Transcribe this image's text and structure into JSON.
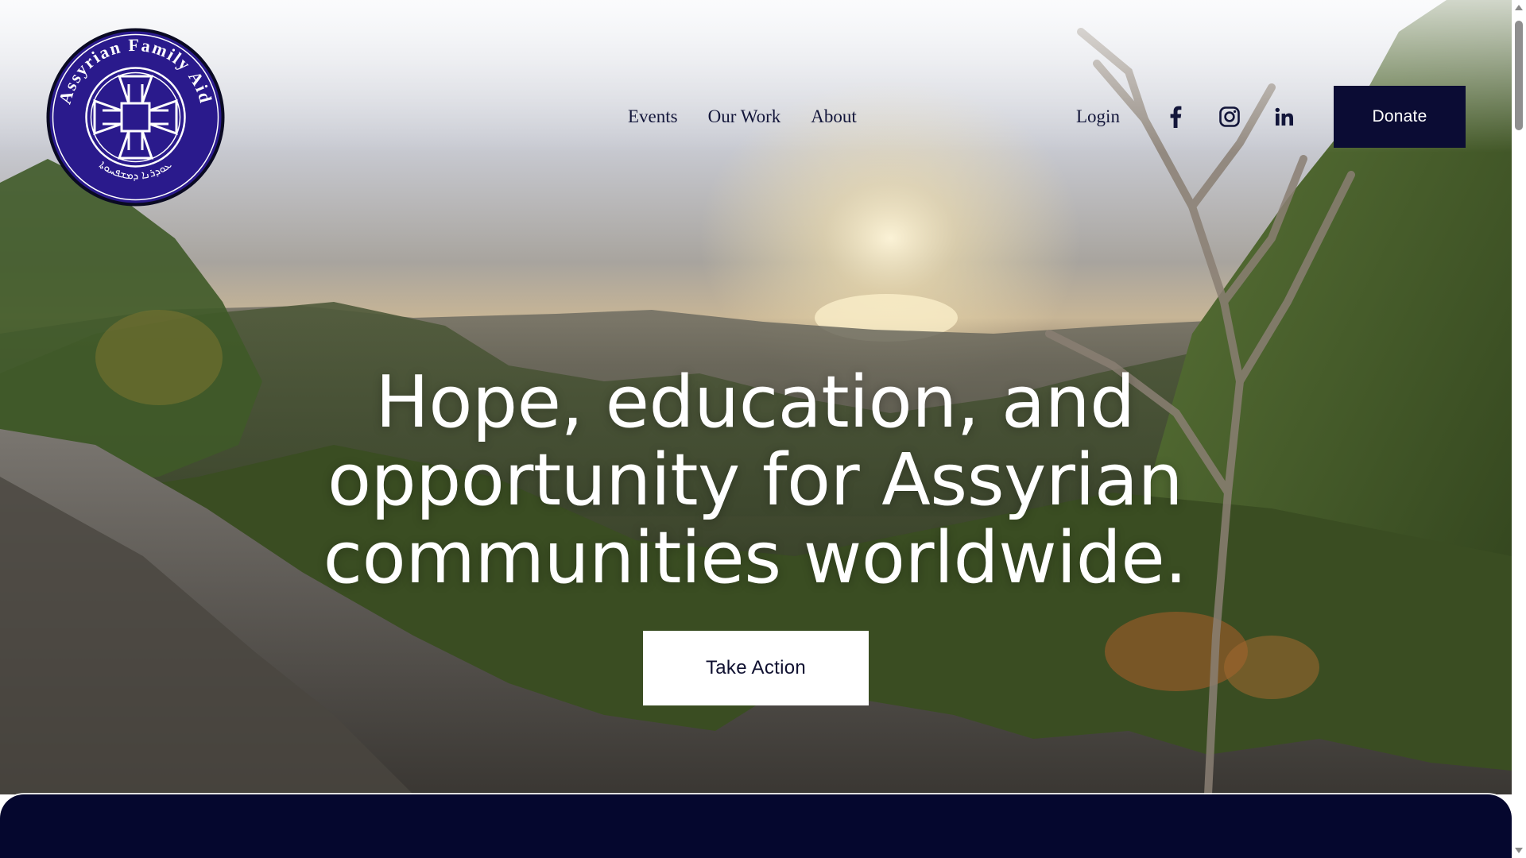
{
  "brand": {
    "logo_name": "Assyrian Family Aid",
    "logo_subtext": "ܥܘܕܪܢܐ ܕܡܫܦܚܘܬܐ"
  },
  "nav": {
    "items": [
      {
        "label": "Events"
      },
      {
        "label": "Our Work"
      },
      {
        "label": "About"
      }
    ],
    "login_label": "Login",
    "donate_label": "Donate"
  },
  "social": {
    "icons": [
      "facebook-icon",
      "instagram-icon",
      "linkedin-icon"
    ]
  },
  "hero": {
    "headline": "Hope, education, and opportunity for Assyrian communities worldwide.",
    "cta_label": "Take Action"
  },
  "colors": {
    "navy": "#0b0c34",
    "panel": "#05072e",
    "logo_ring": "#2a1a8c",
    "text_dark": "#13163a",
    "white": "#ffffff"
  }
}
